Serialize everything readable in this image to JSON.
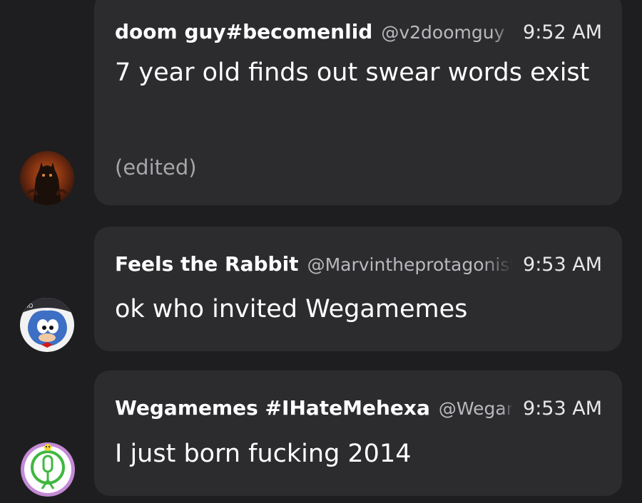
{
  "messages": [
    {
      "username": "doom guy#becomenlid",
      "handle": "@v2doomguy",
      "time": "9:52 AM",
      "text": "7 year old finds out swear words exist",
      "edited": "(edited)",
      "avatar_icon": "dark-creature-avatar"
    },
    {
      "username": "Feels the Rabbit",
      "handle": "@Marvintheprotagonist",
      "time": "9:53 AM",
      "text": "ok who invited Wegamemes",
      "avatar_icon": "blue-hedgehog-avatar"
    },
    {
      "username": "Wegamemes #IHateMehexa",
      "handle": "@Wegamemes",
      "time": "9:53 AM",
      "text": "I just born fucking 2014",
      "avatar_icon": "green-microphone-avatar"
    }
  ],
  "colors": {
    "background": "#1e1e20",
    "bubble": "#2c2c2f",
    "handle": "#b9b9bd",
    "edited": "#a6a6aa"
  }
}
